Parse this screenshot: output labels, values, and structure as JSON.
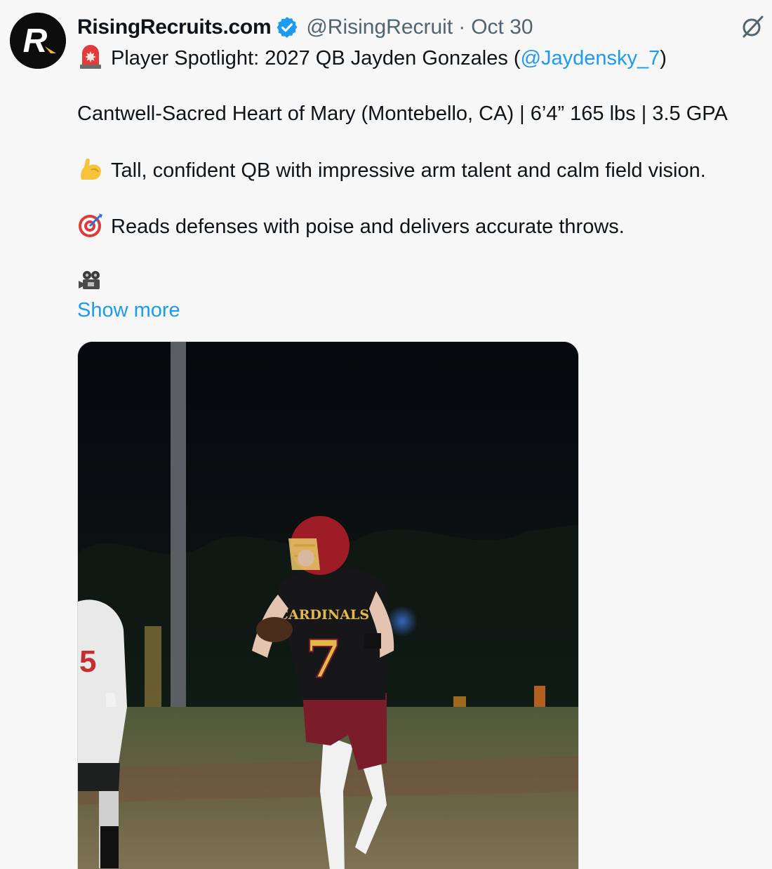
{
  "tweet": {
    "author": {
      "display_name": "RisingRecruits.com",
      "handle": "@RisingRecruit",
      "separator": "·",
      "timestamp": "Oct 30",
      "avatar_letter": "R",
      "verified": true
    },
    "lines": {
      "l1_prefix": "Player Spotlight: 2027 QB Jayden Gonzales (",
      "l1_mention": "@Jaydensky_7",
      "l1_suffix": ")",
      "l2": "Cantwell-Sacred Heart of Mary (Montebello, CA) | 6’4” 165 lbs | 3.5 GPA",
      "l3": "Tall, confident QB with impressive arm talent and calm field vision.",
      "l4": "Reads defenses with poise and delivers accurate throws."
    },
    "show_more": "Show more",
    "media": {
      "jersey_text": "CARDINALS",
      "jersey_number": "7",
      "opponent_number": "5"
    }
  },
  "icons": {
    "siren": "police-light-emoji",
    "flexed_arm": "flexed-biceps-emoji",
    "target": "direct-hit-emoji",
    "camera": "movie-camera-emoji",
    "grok": "grok-icon",
    "verified": "verified-badge-icon"
  },
  "colors": {
    "link": "#1d9bf0",
    "secondary_text": "#536471",
    "background": "#f7f7f7",
    "verified": "#1d9bf0"
  }
}
